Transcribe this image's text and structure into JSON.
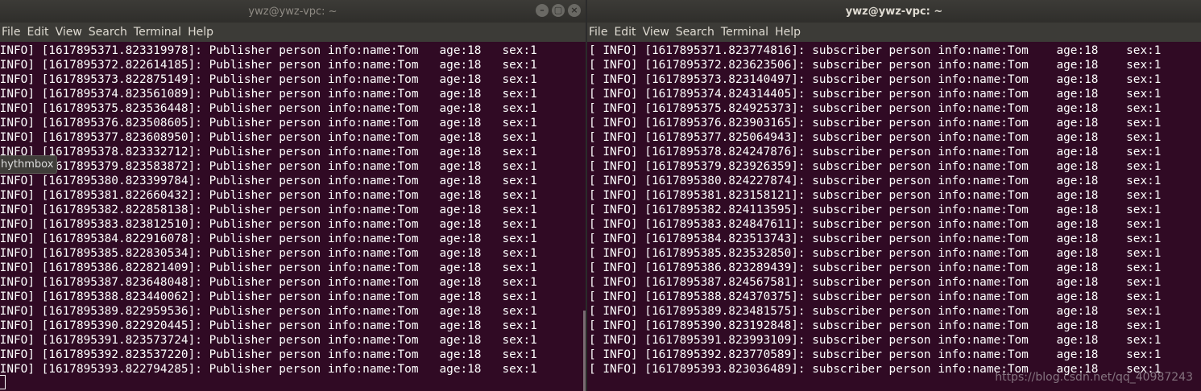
{
  "left_window": {
    "title": "ywz@ywz-vpc: ~",
    "controls": [
      "–",
      "▢",
      "×"
    ],
    "menu": [
      "File",
      "Edit",
      "View",
      "Search",
      "Terminal",
      "Help"
    ],
    "lines": [
      " INFO] [1617895371.823319978]: Publisher person info:name:Tom   age:18   sex:1",
      " INFO] [1617895372.822614185]: Publisher person info:name:Tom   age:18   sex:1",
      " INFO] [1617895373.822875149]: Publisher person info:name:Tom   age:18   sex:1",
      " INFO] [1617895374.823561089]: Publisher person info:name:Tom   age:18   sex:1",
      " INFO] [1617895375.823536448]: Publisher person info:name:Tom   age:18   sex:1",
      " INFO] [1617895376.823508605]: Publisher person info:name:Tom   age:18   sex:1",
      " INFO] [1617895377.823608950]: Publisher person info:name:Tom   age:18   sex:1",
      " INFO] [1617895378.823332712]: Publisher person info:name:Tom   age:18   sex:1",
      " INFO] [1617895379.823583872]: Publisher person info:name:Tom   age:18   sex:1",
      " INFO] [1617895380.823399784]: Publisher person info:name:Tom   age:18   sex:1",
      " INFO] [1617895381.822660432]: Publisher person info:name:Tom   age:18   sex:1",
      " INFO] [1617895382.822858138]: Publisher person info:name:Tom   age:18   sex:1",
      " INFO] [1617895383.823812510]: Publisher person info:name:Tom   age:18   sex:1",
      " INFO] [1617895384.822916078]: Publisher person info:name:Tom   age:18   sex:1",
      " INFO] [1617895385.822830534]: Publisher person info:name:Tom   age:18   sex:1",
      " INFO] [1617895386.822821409]: Publisher person info:name:Tom   age:18   sex:1",
      " INFO] [1617895387.823648048]: Publisher person info:name:Tom   age:18   sex:1",
      " INFO] [1617895388.823440062]: Publisher person info:name:Tom   age:18   sex:1",
      " INFO] [1617895389.822959536]: Publisher person info:name:Tom   age:18   sex:1",
      " INFO] [1617895390.822920445]: Publisher person info:name:Tom   age:18   sex:1",
      " INFO] [1617895391.823573724]: Publisher person info:name:Tom   age:18   sex:1",
      " INFO] [1617895392.823537220]: Publisher person info:name:Tom   age:18   sex:1",
      " INFO] [1617895393.822794285]: Publisher person info:name:Tom   age:18   sex:1"
    ]
  },
  "right_window": {
    "title": "ywz@ywz-vpc: ~",
    "menu": [
      "File",
      "Edit",
      "View",
      "Search",
      "Terminal",
      "Help"
    ],
    "lines": [
      "[ INFO] [1617895371.823774816]: subscriber person info:name:Tom    age:18    sex:1",
      "[ INFO] [1617895372.823623506]: subscriber person info:name:Tom    age:18    sex:1",
      "[ INFO] [1617895373.823140497]: subscriber person info:name:Tom    age:18    sex:1",
      "[ INFO] [1617895374.824314405]: subscriber person info:name:Tom    age:18    sex:1",
      "[ INFO] [1617895375.824925373]: subscriber person info:name:Tom    age:18    sex:1",
      "[ INFO] [1617895376.823903165]: subscriber person info:name:Tom    age:18    sex:1",
      "[ INFO] [1617895377.825064943]: subscriber person info:name:Tom    age:18    sex:1",
      "[ INFO] [1617895378.824247876]: subscriber person info:name:Tom    age:18    sex:1",
      "[ INFO] [1617895379.823926359]: subscriber person info:name:Tom    age:18    sex:1",
      "[ INFO] [1617895380.824227874]: subscriber person info:name:Tom    age:18    sex:1",
      "[ INFO] [1617895381.823158121]: subscriber person info:name:Tom    age:18    sex:1",
      "[ INFO] [1617895382.824113595]: subscriber person info:name:Tom    age:18    sex:1",
      "[ INFO] [1617895383.824847611]: subscriber person info:name:Tom    age:18    sex:1",
      "[ INFO] [1617895384.823513743]: subscriber person info:name:Tom    age:18    sex:1",
      "[ INFO] [1617895385.823532850]: subscriber person info:name:Tom    age:18    sex:1",
      "[ INFO] [1617895386.823289439]: subscriber person info:name:Tom    age:18    sex:1",
      "[ INFO] [1617895387.824567581]: subscriber person info:name:Tom    age:18    sex:1",
      "[ INFO] [1617895388.824370375]: subscriber person info:name:Tom    age:18    sex:1",
      "[ INFO] [1617895389.823481575]: subscriber person info:name:Tom    age:18    sex:1",
      "[ INFO] [1617895390.823192848]: subscriber person info:name:Tom    age:18    sex:1",
      "[ INFO] [1617895391.823993109]: subscriber person info:name:Tom    age:18    sex:1",
      "[ INFO] [1617895392.823770589]: subscriber person info:name:Tom    age:18    sex:1",
      "[ INFO] [1617895393.823036489]: subscriber person info:name:Tom    age:18    sex:1"
    ]
  },
  "tooltip": "hythmbox",
  "watermark": "https://blog.csdn.net/qq_40987243",
  "colors": {
    "terminal_bg": "#300a24",
    "terminal_fg": "#ffffff",
    "titlebar_bg": "#3c3b37",
    "menubar_bg": "#3c3b37",
    "menu_fg": "#dfdbd2"
  }
}
